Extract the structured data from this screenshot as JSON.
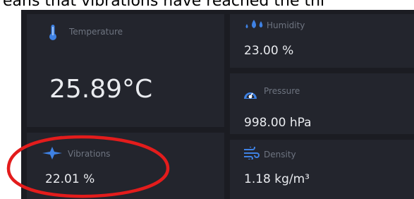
{
  "caption": "eans that vibrations have reached the thi",
  "colors": {
    "background": "#1b1c22",
    "card": "#23252d",
    "label": "#6e7480",
    "value": "#e9ebef",
    "accent_blue": "#3f82e4",
    "annotation_red": "#e31c1c"
  },
  "sensors": {
    "temperature": {
      "label": "Temperature",
      "value": "25.89°C",
      "icon": "thermometer-icon"
    },
    "humidity": {
      "label": "Humidity",
      "value": "23.00 %",
      "icon": "water-drops-icon"
    },
    "pressure": {
      "label": "Pressure",
      "value": "998.00 hPa",
      "icon": "gauge-icon"
    },
    "vibrations": {
      "label": "Vibrations",
      "value": "22.01 %",
      "icon": "vibration-icon"
    },
    "density": {
      "label": "Density",
      "value": "1.18 kg/m³",
      "icon": "wind-icon"
    }
  }
}
